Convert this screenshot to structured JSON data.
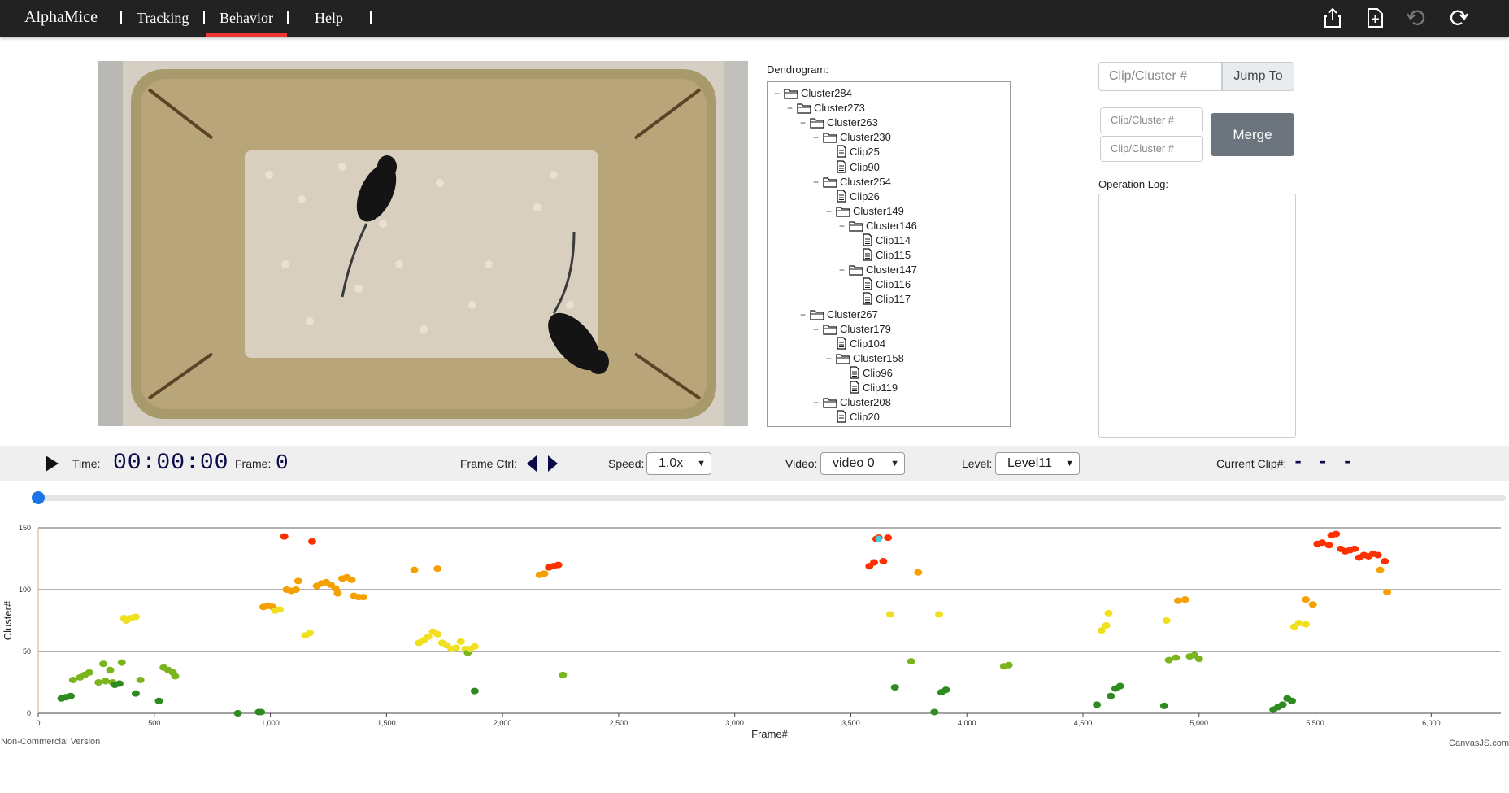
{
  "app": {
    "brand": "AlphaMice"
  },
  "nav": {
    "items": [
      {
        "label": "Tracking"
      },
      {
        "label": "Behavior"
      },
      {
        "label": "Help"
      }
    ],
    "active": "Behavior"
  },
  "toolbar": {
    "icons": [
      "share-icon",
      "add-file-icon",
      "undo-icon",
      "redo-icon"
    ]
  },
  "dendrogram": {
    "label": "Dendrogram:",
    "rows": [
      {
        "type": "folder",
        "text": "Cluster284",
        "depth": 0,
        "toggle": "−"
      },
      {
        "type": "folder",
        "text": "Cluster273",
        "depth": 1,
        "toggle": "−"
      },
      {
        "type": "folder",
        "text": "Cluster263",
        "depth": 2,
        "toggle": "−"
      },
      {
        "type": "folder",
        "text": "Cluster230",
        "depth": 3,
        "toggle": "−"
      },
      {
        "type": "file",
        "text": "Clip25",
        "depth": 4
      },
      {
        "type": "file",
        "text": "Clip90",
        "depth": 4
      },
      {
        "type": "folder",
        "text": "Cluster254",
        "depth": 3,
        "toggle": "−"
      },
      {
        "type": "file",
        "text": "Clip26",
        "depth": 4
      },
      {
        "type": "folder",
        "text": "Cluster149",
        "depth": 4,
        "toggle": "−"
      },
      {
        "type": "folder",
        "text": "Cluster146",
        "depth": 5,
        "toggle": "−"
      },
      {
        "type": "file",
        "text": "Clip114",
        "depth": 6
      },
      {
        "type": "file",
        "text": "Clip115",
        "depth": 6
      },
      {
        "type": "folder",
        "text": "Cluster147",
        "depth": 5,
        "toggle": "−"
      },
      {
        "type": "file",
        "text": "Clip116",
        "depth": 6
      },
      {
        "type": "file",
        "text": "Clip117",
        "depth": 6
      },
      {
        "type": "folder",
        "text": "Cluster267",
        "depth": 2,
        "toggle": "−"
      },
      {
        "type": "folder",
        "text": "Cluster179",
        "depth": 3,
        "toggle": "−"
      },
      {
        "type": "file",
        "text": "Clip104",
        "depth": 4
      },
      {
        "type": "folder",
        "text": "Cluster158",
        "depth": 4,
        "toggle": "−"
      },
      {
        "type": "file",
        "text": "Clip96",
        "depth": 5
      },
      {
        "type": "file",
        "text": "Clip119",
        "depth": 5
      },
      {
        "type": "folder",
        "text": "Cluster208",
        "depth": 3,
        "toggle": "−"
      },
      {
        "type": "file",
        "text": "Clip20",
        "depth": 4
      }
    ]
  },
  "jump": {
    "placeholder": "Clip/Cluster #",
    "button": "Jump To"
  },
  "merge": {
    "placeholder1": "Clip/Cluster #",
    "placeholder2": "Clip/Cluster #",
    "button": "Merge"
  },
  "oplog": {
    "label": "Operation Log:"
  },
  "controls": {
    "time_label": "Time:",
    "time_value": "00:00:00",
    "frame_label": "Frame:",
    "frame_value": "0",
    "frame_ctrl_label": "Frame Ctrl:",
    "speed_label": "Speed:",
    "speed_value": "1.0x",
    "video_label": "Video:",
    "video_value": "video 0",
    "level_label": "Level:",
    "level_value": "Level11",
    "clip_label": "Current Clip#:",
    "clip_value": "- - -"
  },
  "slider": {
    "value": 0
  },
  "chart_data": {
    "type": "scatter",
    "xlabel": "Frame#",
    "ylabel": "Cluster#",
    "xlim": [
      0,
      6300
    ],
    "ylim": [
      0,
      150
    ],
    "xticks": [
      0,
      500,
      1000,
      1500,
      2000,
      2500,
      3000,
      3500,
      4000,
      4500,
      5000,
      5500,
      6000
    ],
    "xtick_labels": [
      "0",
      "500",
      "1,000",
      "1,500",
      "2,000",
      "2,500",
      "3,000",
      "3,500",
      "4,000",
      "4,500",
      "5,000",
      "5,500",
      "6,000"
    ],
    "yticks": [
      0,
      50,
      100,
      150
    ],
    "grid": true,
    "colors": {
      "low": "#2e8b1f",
      "mid_low": "#7ab51d",
      "mid": "#f0e020",
      "mid_high": "#f5a000",
      "high": "#ff3000",
      "highlight": "#40d0e0"
    },
    "points": [
      [
        100,
        12
      ],
      [
        120,
        13
      ],
      [
        140,
        14
      ],
      [
        150,
        27
      ],
      [
        180,
        29
      ],
      [
        200,
        31
      ],
      [
        220,
        33
      ],
      [
        260,
        25
      ],
      [
        280,
        40
      ],
      [
        290,
        26
      ],
      [
        310,
        35
      ],
      [
        320,
        25
      ],
      [
        330,
        23
      ],
      [
        350,
        24
      ],
      [
        360,
        41
      ],
      [
        420,
        16
      ],
      [
        440,
        27
      ],
      [
        520,
        10
      ],
      [
        540,
        37
      ],
      [
        560,
        35
      ],
      [
        580,
        33
      ],
      [
        590,
        30
      ],
      [
        370,
        77
      ],
      [
        380,
        75
      ],
      [
        400,
        77
      ],
      [
        420,
        78
      ],
      [
        860,
        0
      ],
      [
        950,
        1
      ],
      [
        960,
        1
      ],
      [
        970,
        86
      ],
      [
        990,
        87
      ],
      [
        1010,
        86
      ],
      [
        1020,
        83
      ],
      [
        1040,
        84
      ],
      [
        1060,
        143
      ],
      [
        1070,
        100
      ],
      [
        1090,
        99
      ],
      [
        1110,
        100
      ],
      [
        1120,
        107
      ],
      [
        1150,
        63
      ],
      [
        1170,
        65
      ],
      [
        1180,
        139
      ],
      [
        1200,
        103
      ],
      [
        1220,
        105
      ],
      [
        1240,
        106
      ],
      [
        1260,
        104
      ],
      [
        1280,
        101
      ],
      [
        1290,
        97
      ],
      [
        1310,
        109
      ],
      [
        1330,
        110
      ],
      [
        1350,
        108
      ],
      [
        1360,
        95
      ],
      [
        1380,
        94
      ],
      [
        1400,
        94
      ],
      [
        1620,
        116
      ],
      [
        1720,
        117
      ],
      [
        1640,
        57
      ],
      [
        1660,
        59
      ],
      [
        1680,
        62
      ],
      [
        1700,
        66
      ],
      [
        1720,
        64
      ],
      [
        1740,
        57
      ],
      [
        1760,
        55
      ],
      [
        1780,
        52
      ],
      [
        1800,
        53
      ],
      [
        1820,
        58
      ],
      [
        1840,
        52
      ],
      [
        1850,
        49
      ],
      [
        1860,
        52
      ],
      [
        1880,
        54
      ],
      [
        1880,
        18
      ],
      [
        2160,
        112
      ],
      [
        2180,
        113
      ],
      [
        2200,
        118
      ],
      [
        2220,
        119
      ],
      [
        2240,
        120
      ],
      [
        2260,
        31
      ],
      [
        3580,
        119
      ],
      [
        3600,
        122
      ],
      [
        3610,
        141
      ],
      [
        3620,
        142
      ],
      [
        3640,
        123
      ],
      [
        3660,
        142
      ],
      [
        3670,
        80
      ],
      [
        3690,
        21
      ],
      [
        3760,
        42
      ],
      [
        3790,
        114
      ],
      [
        3860,
        1
      ],
      [
        3880,
        80
      ],
      [
        3890,
        17
      ],
      [
        3910,
        19
      ],
      [
        4160,
        38
      ],
      [
        4180,
        39
      ],
      [
        4560,
        7
      ],
      [
        4580,
        67
      ],
      [
        4600,
        71
      ],
      [
        4610,
        81
      ],
      [
        4620,
        14
      ],
      [
        4640,
        20
      ],
      [
        4660,
        22
      ],
      [
        4850,
        6
      ],
      [
        4860,
        75
      ],
      [
        4870,
        43
      ],
      [
        4900,
        45
      ],
      [
        4910,
        91
      ],
      [
        4940,
        92
      ],
      [
        4960,
        46
      ],
      [
        4980,
        47
      ],
      [
        5000,
        44
      ],
      [
        5320,
        3
      ],
      [
        5340,
        5
      ],
      [
        5360,
        7
      ],
      [
        5380,
        12
      ],
      [
        5400,
        10
      ],
      [
        5410,
        70
      ],
      [
        5430,
        73
      ],
      [
        5460,
        72
      ],
      [
        5460,
        92
      ],
      [
        5490,
        88
      ],
      [
        5510,
        137
      ],
      [
        5530,
        138
      ],
      [
        5560,
        136
      ],
      [
        5570,
        144
      ],
      [
        5590,
        145
      ],
      [
        5610,
        133
      ],
      [
        5630,
        131
      ],
      [
        5650,
        132
      ],
      [
        5670,
        133
      ],
      [
        5690,
        126
      ],
      [
        5710,
        128
      ],
      [
        5730,
        127
      ],
      [
        5750,
        129
      ],
      [
        5770,
        128
      ],
      [
        5780,
        116
      ],
      [
        5800,
        123
      ],
      [
        5810,
        98
      ]
    ],
    "highlight_point": [
      3620,
      141
    ]
  },
  "footer": {
    "left": "Non-Commercial Version",
    "right": "CanvasJS.com"
  }
}
